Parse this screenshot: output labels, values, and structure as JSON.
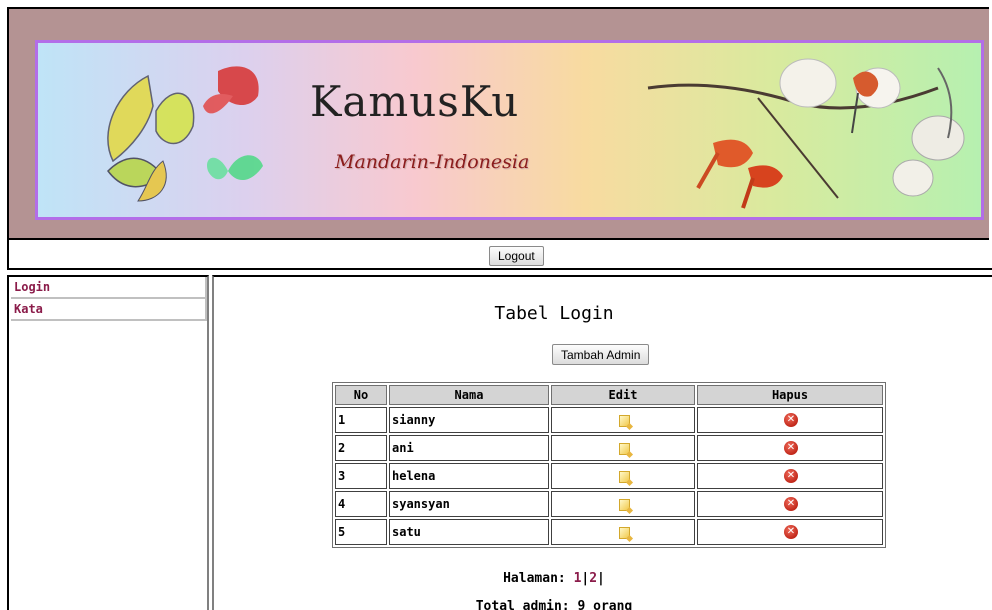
{
  "header": {
    "title": "KamusKu",
    "subtitle": "Mandarin-Indonesia"
  },
  "toolbar": {
    "logout_label": "Logout"
  },
  "sidebar": {
    "items": [
      {
        "label": "Login"
      },
      {
        "label": "Kata"
      }
    ]
  },
  "main": {
    "title": "Tabel Login",
    "add_button_label": "Tambah Admin",
    "table": {
      "columns": [
        "No",
        "Nama",
        "Edit",
        "Hapus"
      ],
      "rows": [
        {
          "no": "1",
          "nama": "sianny"
        },
        {
          "no": "2",
          "nama": "ani"
        },
        {
          "no": "3",
          "nama": "helena"
        },
        {
          "no": "4",
          "nama": "syansyan"
        },
        {
          "no": "5",
          "nama": "satu"
        }
      ],
      "edit_icon": "edit-icon",
      "delete_icon": "delete-icon"
    },
    "pagination": {
      "label": "Halaman:",
      "pages": [
        "1",
        "2"
      ]
    },
    "total_text": "Total admin: 9 orang"
  },
  "colors": {
    "header_bg": "#b49393",
    "banner_border": "#b36ee8",
    "link": "#8b1c4a"
  }
}
